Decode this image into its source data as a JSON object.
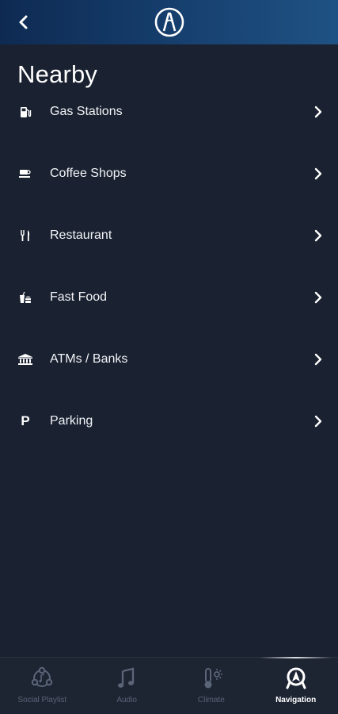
{
  "header": {
    "back_icon": "chevron-left-icon",
    "logo_icon": "acura-logo-icon"
  },
  "page": {
    "title": "Nearby"
  },
  "nearby": {
    "items": [
      {
        "label": "Gas Stations",
        "icon": "gas-pump-icon"
      },
      {
        "label": "Coffee Shops",
        "icon": "coffee-cup-icon"
      },
      {
        "label": "Restaurant",
        "icon": "fork-knife-icon"
      },
      {
        "label": "Fast Food",
        "icon": "fast-food-icon"
      },
      {
        "label": "ATMs / Banks",
        "icon": "bank-icon"
      },
      {
        "label": "Parking",
        "icon": "parking-icon",
        "glyph": "P"
      }
    ]
  },
  "bottom_nav": {
    "tabs": [
      {
        "label": "Social Playlist",
        "icon": "social-playlist-icon",
        "active": false
      },
      {
        "label": "Audio",
        "icon": "music-note-icon",
        "active": false
      },
      {
        "label": "Climate",
        "icon": "climate-icon",
        "active": false
      },
      {
        "label": "Navigation",
        "icon": "navigation-icon",
        "active": true
      }
    ]
  },
  "colors": {
    "background": "#1a2130",
    "header_start": "#0e2a52",
    "header_end": "#1f5284",
    "text": "#ffffff",
    "inactive_tab": "#5a6578"
  }
}
